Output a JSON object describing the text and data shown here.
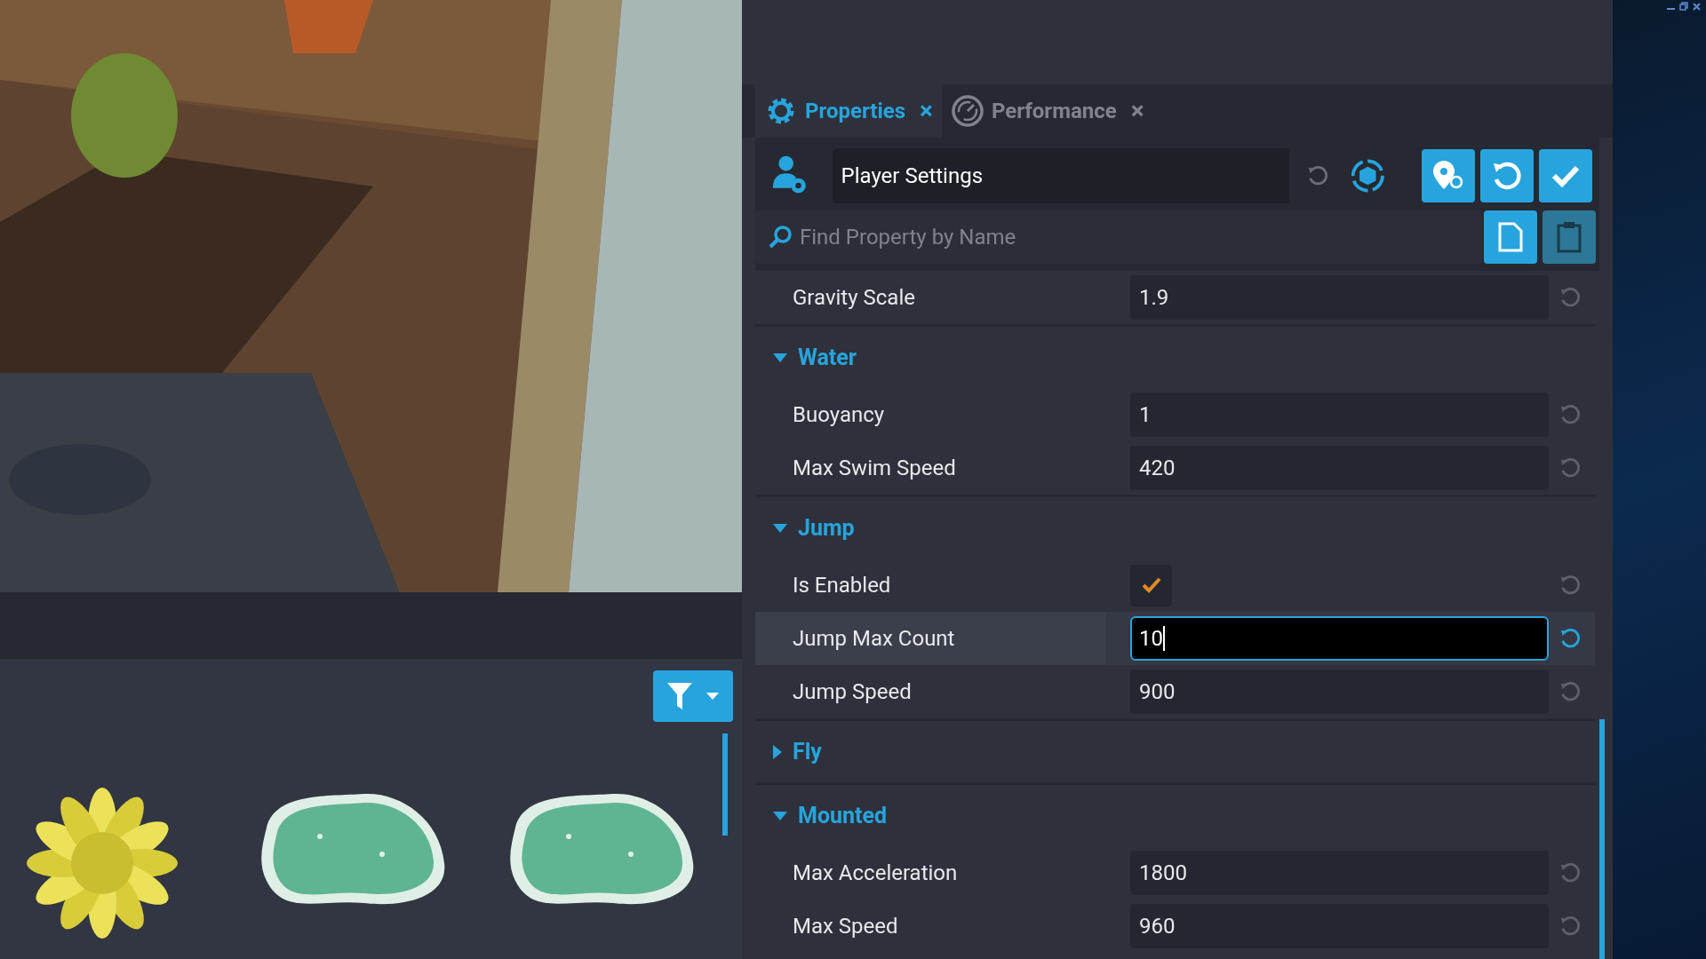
{
  "tabs": [
    {
      "label": "Properties",
      "selected": true,
      "close": "×"
    },
    {
      "label": "Performance",
      "selected": false,
      "close": "×"
    }
  ],
  "object_name": "Player Settings",
  "search": {
    "placeholder": "Find Property by Name"
  },
  "properties": [
    {
      "kind": "field",
      "label": "Gravity Scale",
      "value": "1.9",
      "selected": false
    },
    {
      "kind": "section",
      "label": "Water",
      "expanded": true
    },
    {
      "kind": "field",
      "label": "Buoyancy",
      "value": "1",
      "selected": false
    },
    {
      "kind": "field",
      "label": "Max Swim Speed",
      "value": "420",
      "selected": false
    },
    {
      "kind": "section",
      "label": "Jump",
      "expanded": true
    },
    {
      "kind": "checkbox",
      "label": "Is Enabled",
      "checked": true,
      "selected": false
    },
    {
      "kind": "field",
      "label": "Jump Max Count",
      "value": "10",
      "selected": true
    },
    {
      "kind": "field",
      "label": "Jump Speed",
      "value": "900",
      "selected": false
    },
    {
      "kind": "section",
      "label": "Fly",
      "expanded": false
    },
    {
      "kind": "section",
      "label": "Mounted",
      "expanded": true
    },
    {
      "kind": "field",
      "label": "Max Acceleration",
      "value": "1800",
      "selected": false
    },
    {
      "kind": "field",
      "label": "Max Speed",
      "value": "960",
      "selected": false
    }
  ],
  "assets": [
    {
      "kind": "coral"
    },
    {
      "kind": "puddle"
    },
    {
      "kind": "puddle"
    }
  ]
}
